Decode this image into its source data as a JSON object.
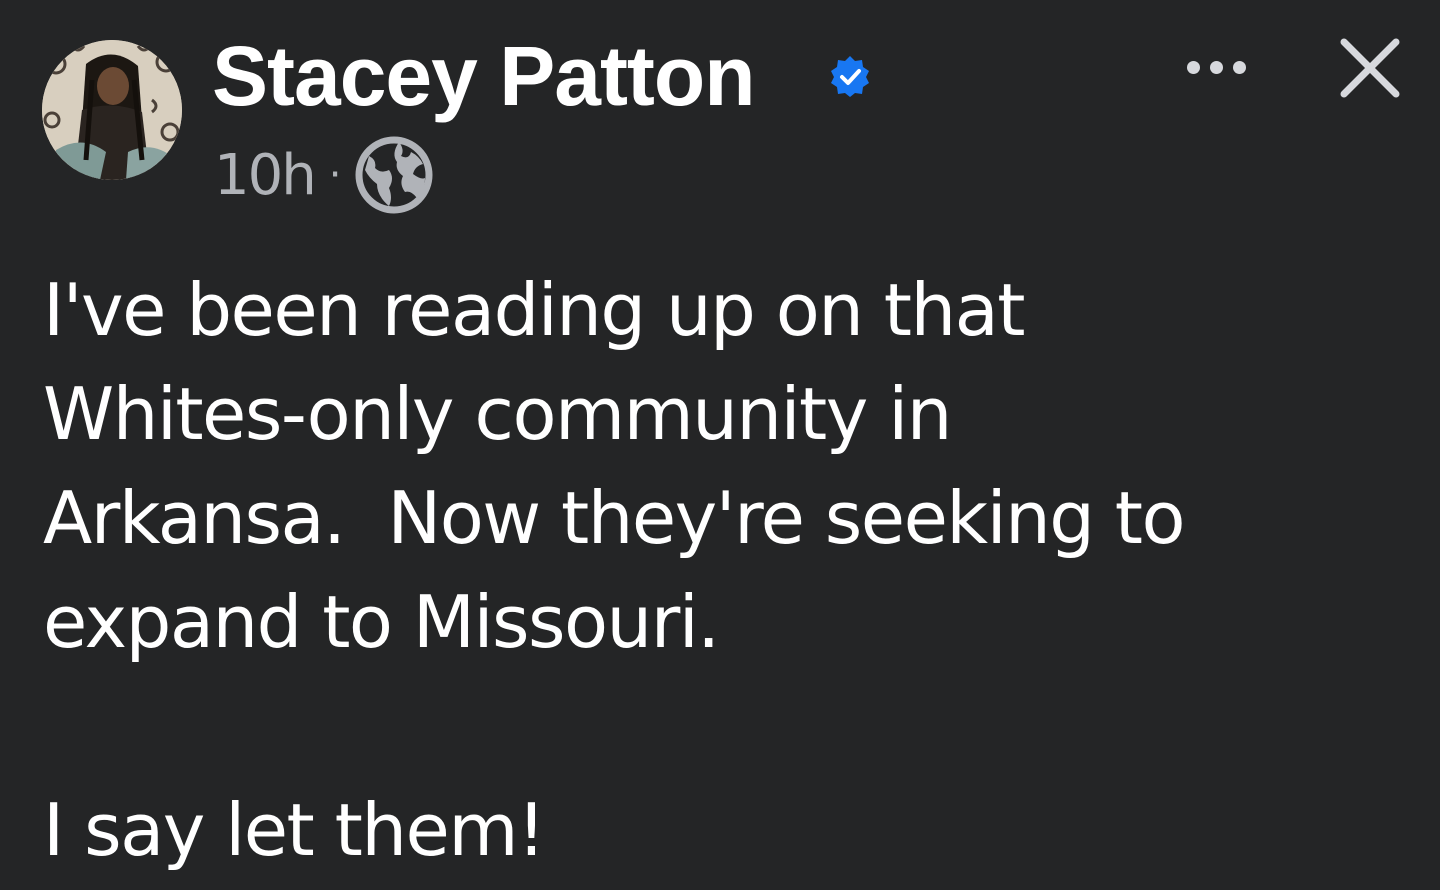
{
  "post": {
    "author": {
      "name": "Stacey Patton",
      "verified": true,
      "avatar_icon": "profile-photo"
    },
    "timestamp": "10h",
    "separator": "·",
    "audience_icon": "globe-icon",
    "more_icon": "more-options-icon",
    "close_icon": "close-icon",
    "text": {
      "paragraph_1": "I've been reading up on that\nWhites-only community in\nArkansa.  Now they're seeking to\nexpand to Missouri.",
      "paragraph_2": "I say let them!"
    }
  },
  "colors": {
    "background": "#242526",
    "primary_text": "#ffffff",
    "secondary_text": "#b0b3b8",
    "verified_badge": "#1877f2"
  }
}
